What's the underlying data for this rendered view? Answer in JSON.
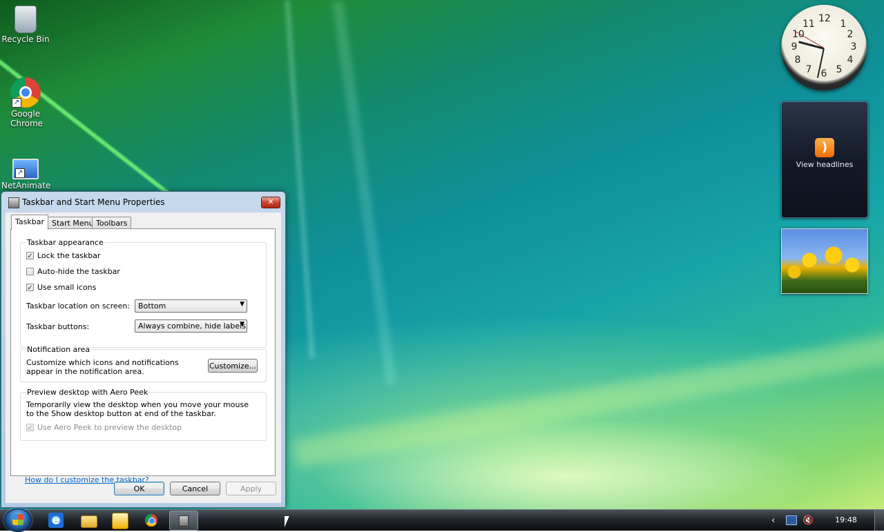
{
  "desktop": {
    "icons": [
      {
        "label": "Recycle Bin",
        "icon": "recycle-bin-icon"
      },
      {
        "label": "Google Chrome",
        "icon": "chrome-icon"
      },
      {
        "label": "NetAnimate",
        "icon": "network-icon"
      }
    ],
    "gadgets": {
      "clock": {
        "hour_labels": [
          "12",
          "1",
          "2",
          "3",
          "4",
          "5",
          "6",
          "7",
          "8",
          "9",
          "10",
          "11"
        ]
      },
      "feed": {
        "label": "View headlines",
        "icon": "rss-icon"
      },
      "slideshow": {
        "subject": "tulips-photo"
      }
    }
  },
  "dialog": {
    "title": "Taskbar and Start Menu Properties",
    "tabs": [
      {
        "label": "Taskbar",
        "active": true
      },
      {
        "label": "Start Menu",
        "active": false
      },
      {
        "label": "Toolbars",
        "active": false
      }
    ],
    "appearance": {
      "title": "Taskbar appearance",
      "lock": {
        "label": "Lock the taskbar",
        "checked": true
      },
      "autohide": {
        "label": "Auto-hide the taskbar",
        "checked": false
      },
      "small_icons": {
        "label": "Use small icons",
        "checked": true
      },
      "location": {
        "label": "Taskbar location on screen:",
        "value": "Bottom"
      },
      "buttons": {
        "label": "Taskbar buttons:",
        "value": "Always combine, hide labels"
      }
    },
    "notification": {
      "title": "Notification area",
      "text": "Customize which icons and notifications appear in the notification area.",
      "customize_label": "Customize..."
    },
    "aero_peek": {
      "title": "Preview desktop with Aero Peek",
      "text": "Temporarily view the desktop when you move your mouse to the Show desktop button at end of the taskbar.",
      "use_label": "Use Aero Peek to preview the desktop",
      "checked": true,
      "disabled": true
    },
    "help_link": "How do I customize the taskbar?",
    "buttons": {
      "ok": "OK",
      "cancel": "Cancel",
      "apply": "Apply"
    },
    "close_glyph": "✕"
  },
  "taskbar": {
    "pinned": [
      "internet-explorer-icon",
      "folder-icon",
      "media-player-icon",
      "chrome-icon",
      "properties-window-icon"
    ],
    "tray": [
      "chevron-left-icon",
      "network-icon",
      "volume-muted-icon"
    ],
    "time": "19:48"
  }
}
